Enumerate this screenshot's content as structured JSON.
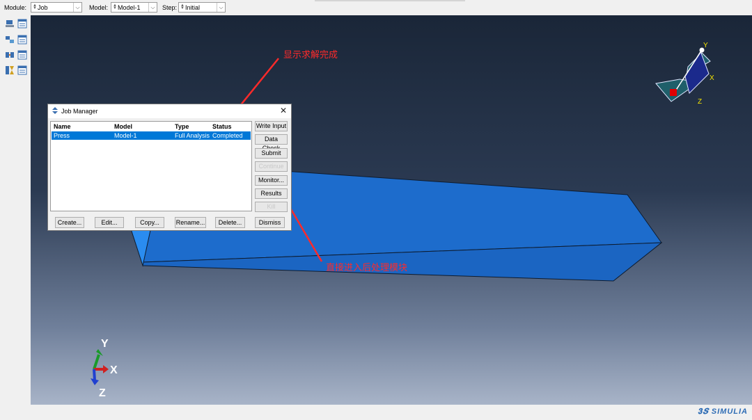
{
  "context_bar": {
    "module_label": "Module:",
    "module_value": "Job",
    "model_label": "Model:",
    "model_value": "Model-1",
    "step_label": "Step:",
    "step_value": "Initial"
  },
  "annotations": {
    "top": "显示求解完成",
    "bottom": "直接进入后处理模块"
  },
  "triad_small": {
    "x": "X",
    "y": "Y",
    "z": "Z"
  },
  "triad_large": {
    "x": "X",
    "y": "Y",
    "z": "Z"
  },
  "job_manager": {
    "title": "Job Manager",
    "columns": [
      "Name",
      "Model",
      "Type",
      "Status"
    ],
    "rows": [
      {
        "name": "Press",
        "model": "Model-1",
        "type": "Full Analysis",
        "status": "Completed"
      }
    ],
    "side_buttons": {
      "write_input": "Write Input",
      "data_check": "Data Check",
      "submit": "Submit",
      "continue": "Continue",
      "monitor": "Monitor...",
      "results": "Results",
      "kill": "Kill"
    },
    "bottom_buttons": {
      "create": "Create...",
      "edit": "Edit...",
      "copy": "Copy...",
      "rename": "Rename...",
      "delete": "Delete...",
      "dismiss": "Dismiss"
    },
    "selected_color": "#0078d7"
  },
  "brand": "SIMULIA",
  "colors": {
    "part": "#1f6fd0",
    "annotation": "#ff2a2a",
    "viewport_top": "#1a2638",
    "viewport_bottom": "#a8b4c8"
  }
}
